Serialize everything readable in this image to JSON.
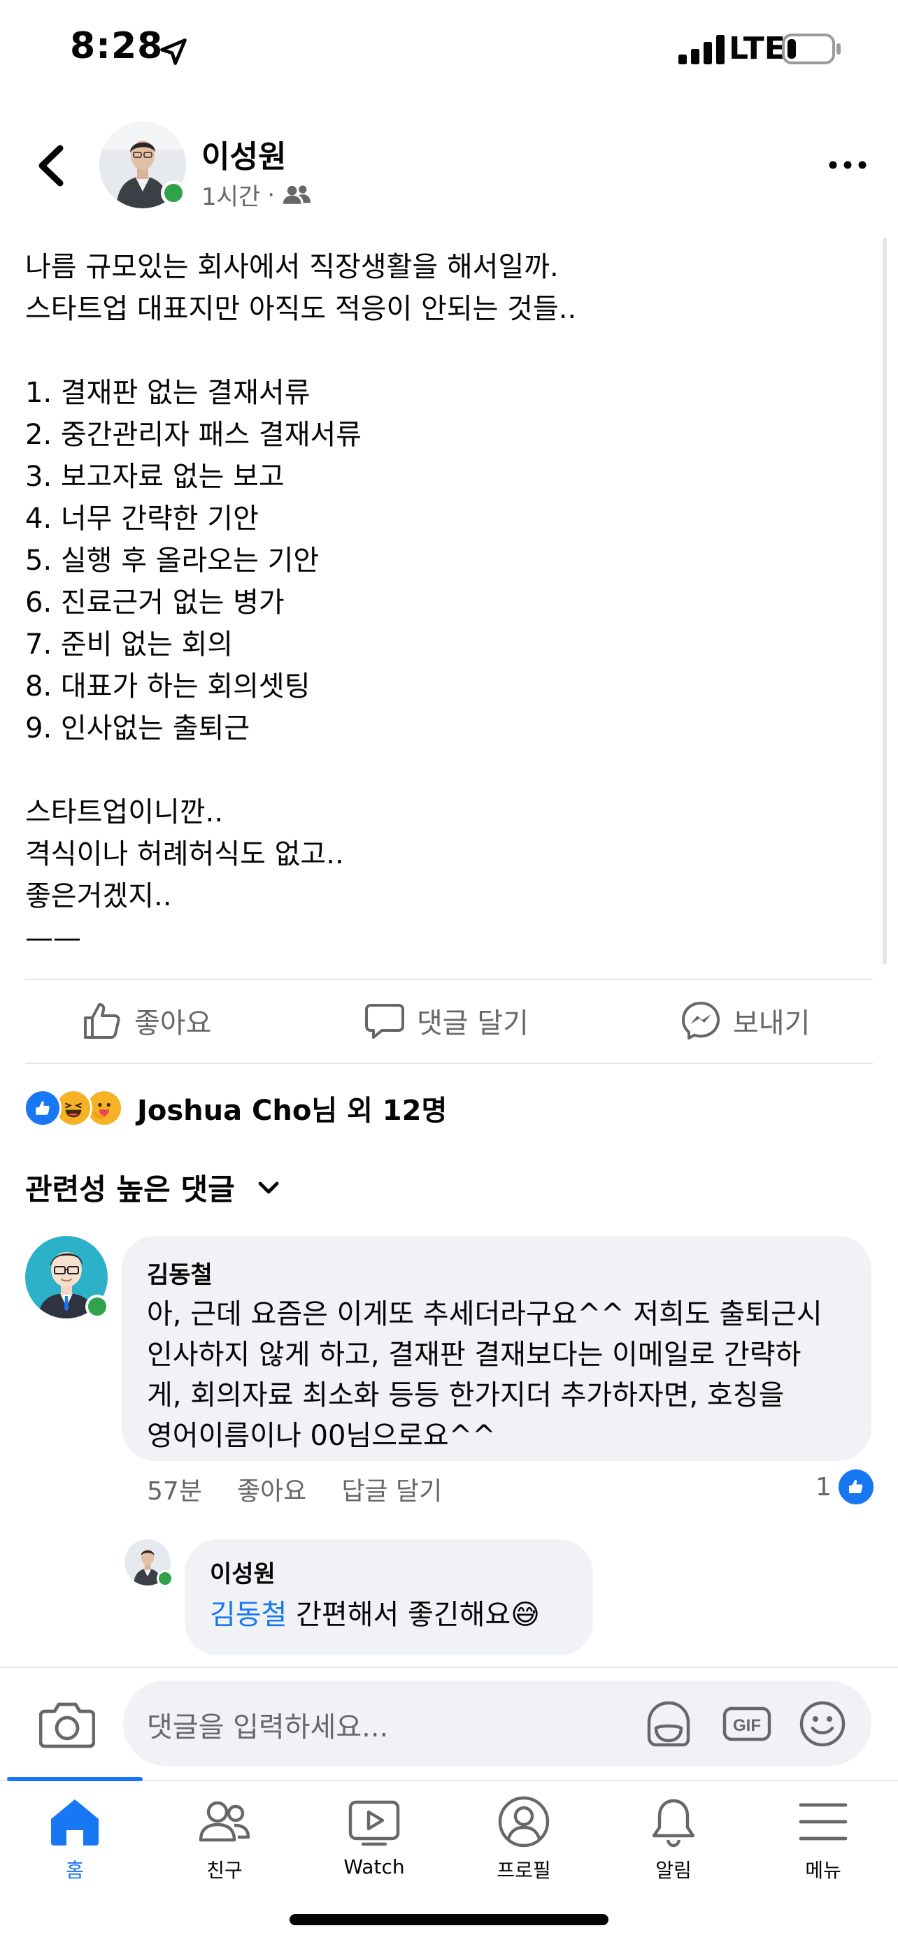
{
  "status_bar": {
    "time": "8:28",
    "network": "LTE"
  },
  "post": {
    "author": "이성원",
    "time": "1시간",
    "separator": "·",
    "privacy_icon": "friends-icon",
    "lines": [
      "나름 규모있는 회사에서 직장생활을 해서일까.",
      "스타트업 대표지만 아직도 적응이 안되는 것들..",
      "",
      "1. 결재판 없는 결재서류",
      "2. 중간관리자 패스 결재서류",
      "3. 보고자료 없는 보고",
      "4. 너무 간략한 기안",
      "5. 실행 후 올라오는 기안",
      "6. 진료근거 없는 병가",
      "7. 준비 없는 회의",
      "8. 대표가 하는 회의셋팅",
      "9. 인사없는 출퇴근",
      "",
      "스타트업이니깐..",
      "격식이나 허례허식도 없고..",
      "좋은거겠지..",
      "——"
    ]
  },
  "actions": {
    "like": "좋아요",
    "comment": "댓글 달기",
    "send": "보내기"
  },
  "reactions": {
    "summary": "Joshua Cho님 외 12명",
    "icons": [
      "like-reaction-icon",
      "haha-reaction-icon",
      "care-reaction-icon"
    ]
  },
  "comments_header": "관련성 높은 댓글",
  "comment": {
    "author": "김동철",
    "lines": [
      "아, 근데 요즘은 이게또 추세더라구요^^ 저희도 출퇴근시",
      "인사하지 않게 하고, 결재판 결재보다는 이메일로 간략하",
      "게, 회의자료 최소화 등등 한가지더 추가하자면, 호칭을",
      "영어이름이나 00님으로요^^"
    ],
    "time": "57분",
    "like": "좋아요",
    "reply": "답글 달기",
    "like_count": "1"
  },
  "reply": {
    "author": "이성원",
    "mention": "김동철",
    "text": " 간편해서 좋긴해요",
    "emoji": "😅"
  },
  "composer": {
    "placeholder": "댓글을 입력하세요..."
  },
  "nav": {
    "home": "홈",
    "friends": "친구",
    "watch": "Watch",
    "profile": "프로필",
    "notifications": "알림",
    "menu": "메뉴"
  },
  "colors": {
    "accent": "#1877f2",
    "online": "#31a24c",
    "bubble": "#f0f2f5",
    "secondary_text": "#65676b"
  }
}
